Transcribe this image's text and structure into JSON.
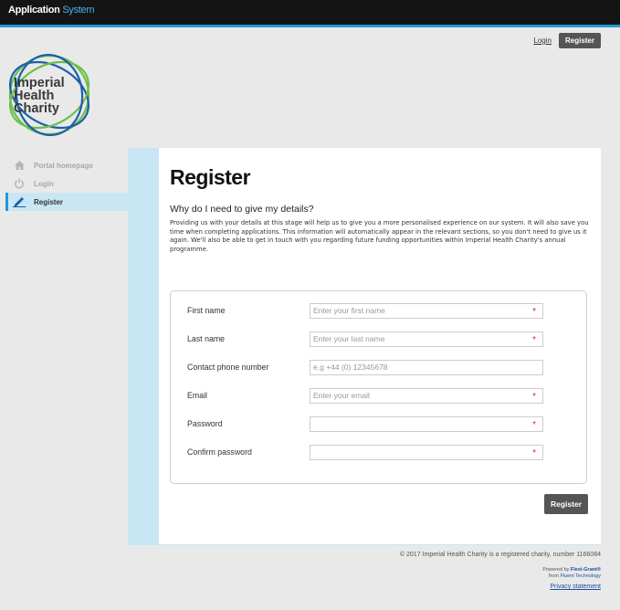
{
  "app": {
    "title_main": "Application",
    "title_sub": "System"
  },
  "header": {
    "login_label": "Login",
    "register_label": "Register"
  },
  "logo": {
    "line1": "Imperial",
    "line2": "Health",
    "line3": "Charity"
  },
  "sidebar": {
    "items": [
      {
        "label": "Portal homepage",
        "icon": "home-icon"
      },
      {
        "label": "Login",
        "icon": "power-icon"
      },
      {
        "label": "Register",
        "icon": "pencil-icon",
        "active": true
      }
    ]
  },
  "main": {
    "title": "Register",
    "subtitle": "Why do I need to give my details?",
    "intro": "Providing us with your details at this stage will help us to give you a more personalised experience on our system. It will also save you time when completing applications. This information will automatically appear in the relevant sections, so you don't need to give us it again. We'll also be able to get in touch with you regarding future funding opportunities within Imperial Health Charity's annual programme."
  },
  "form": {
    "fields": [
      {
        "label": "First name",
        "placeholder": "Enter your first name",
        "required": true
      },
      {
        "label": "Last name",
        "placeholder": "Enter your last name",
        "required": true
      },
      {
        "label": "Contact phone number",
        "placeholder": "e.g +44 (0) 12345678",
        "required": false
      },
      {
        "label": "Email",
        "placeholder": "Enter your email",
        "required": true
      },
      {
        "label": "Password",
        "placeholder": "",
        "required": true
      },
      {
        "label": "Confirm password",
        "placeholder": "",
        "required": true
      }
    ],
    "required_mark": "*",
    "submit_label": "Register"
  },
  "footer": {
    "copyright": "© 2017 Imperial Health Charity is a registered charity, number 1166084",
    "powered_by": "Powered by",
    "product": "Flexi-Grant®",
    "from": "from",
    "company": "Fluent Technology",
    "privacy": "Privacy statement"
  },
  "colors": {
    "accent": "#1f9ad6",
    "panel": "#c9e6f5",
    "logo_green": "#6cc04a",
    "logo_blue": "#1b5fa8",
    "required": "#d92a2a"
  }
}
